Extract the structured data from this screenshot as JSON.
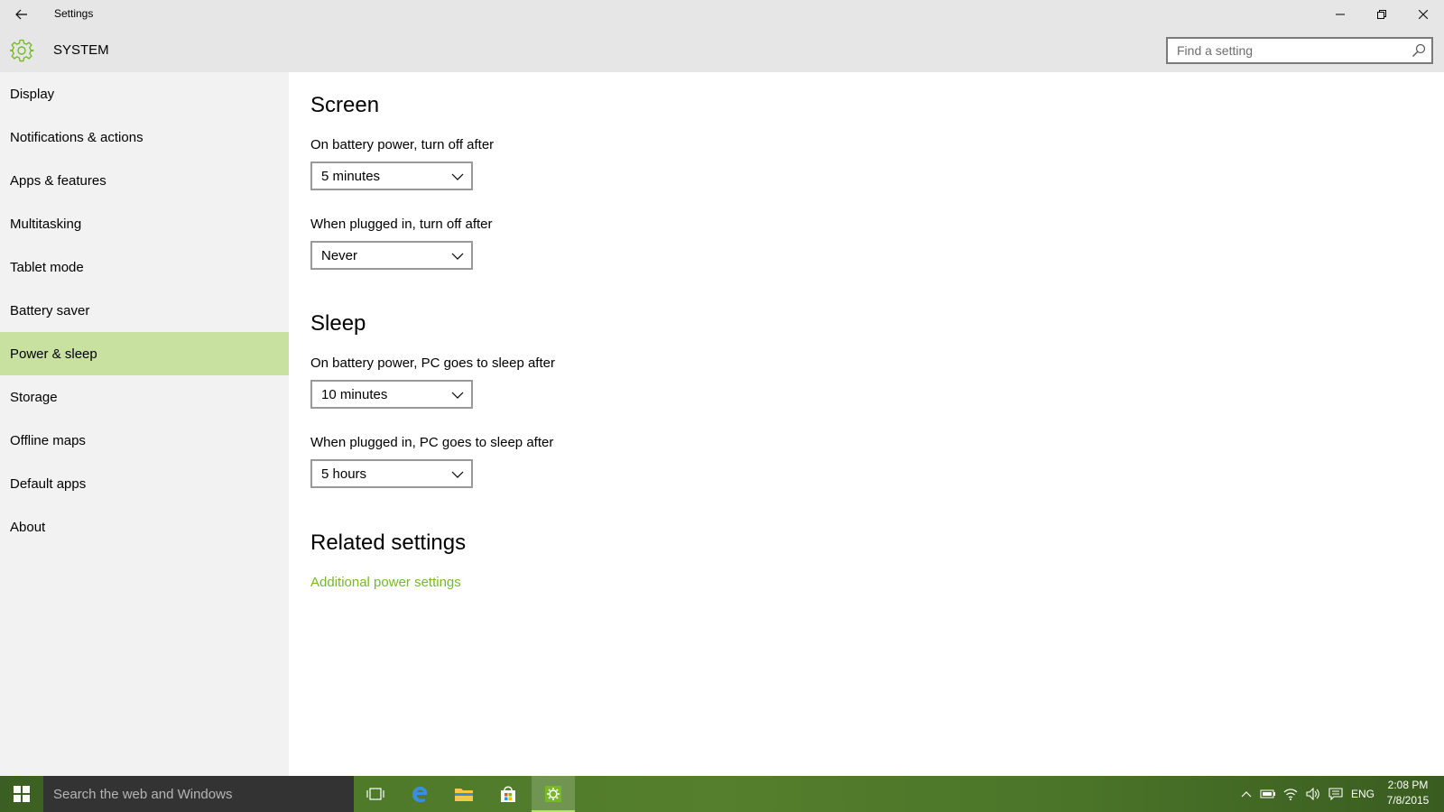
{
  "window": {
    "title": "Settings"
  },
  "header": {
    "section_title": "SYSTEM",
    "search_placeholder": "Find a setting"
  },
  "sidebar": {
    "items": [
      {
        "label": "Display"
      },
      {
        "label": "Notifications & actions"
      },
      {
        "label": "Apps & features"
      },
      {
        "label": "Multitasking"
      },
      {
        "label": "Tablet mode"
      },
      {
        "label": "Battery saver"
      },
      {
        "label": "Power & sleep",
        "selected": true
      },
      {
        "label": "Storage"
      },
      {
        "label": "Offline maps"
      },
      {
        "label": "Default apps"
      },
      {
        "label": "About"
      }
    ]
  },
  "main": {
    "screen": {
      "heading": "Screen",
      "battery_label": "On battery power, turn off after",
      "battery_value": "5 minutes",
      "plugged_label": "When plugged in, turn off after",
      "plugged_value": "Never"
    },
    "sleep": {
      "heading": "Sleep",
      "battery_label": "On battery power, PC goes to sleep after",
      "battery_value": "10 minutes",
      "plugged_label": "When plugged in, PC goes to sleep after",
      "plugged_value": "5 hours"
    },
    "related": {
      "heading": "Related settings",
      "link": "Additional power settings"
    }
  },
  "taskbar": {
    "search_placeholder": "Search the web and Windows",
    "language": "ENG",
    "time": "2:08 PM",
    "date": "7/8/2015"
  },
  "colors": {
    "accent": "#76b82a",
    "selected_bg": "#c8e1a1",
    "sidebar_bg": "#f2f2f2",
    "titlebar_bg": "#e6e6e6"
  }
}
